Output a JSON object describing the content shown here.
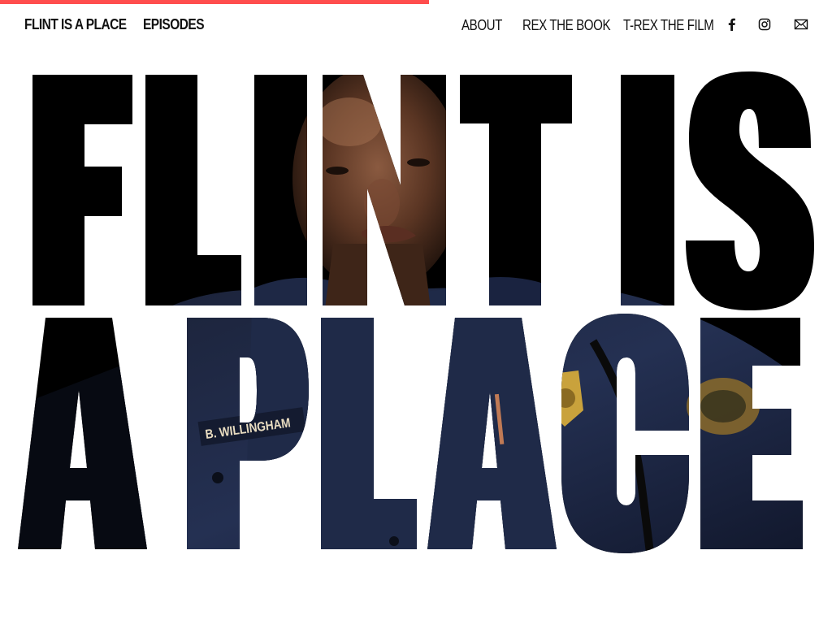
{
  "header": {
    "scroll_progress_percent": 51.5,
    "brand_label": "FLINT IS A PLACE",
    "episodes_label": "EPISODES",
    "nav_links": [
      "ABOUT",
      "REX THE BOOK",
      "T-REX THE FILM"
    ],
    "social_icons": [
      "facebook-icon",
      "instagram-icon",
      "mail-icon"
    ]
  },
  "hero": {
    "title_line1": "FLINT IS",
    "title_line2": "A PLACE",
    "photo_badge_text": "B. WILLINGHAM"
  },
  "colors": {
    "accent": "#ff4d4d",
    "text": "#111111",
    "background": "#ffffff",
    "letter_fill": "#000000",
    "uniform_navy": "#1d2740"
  }
}
